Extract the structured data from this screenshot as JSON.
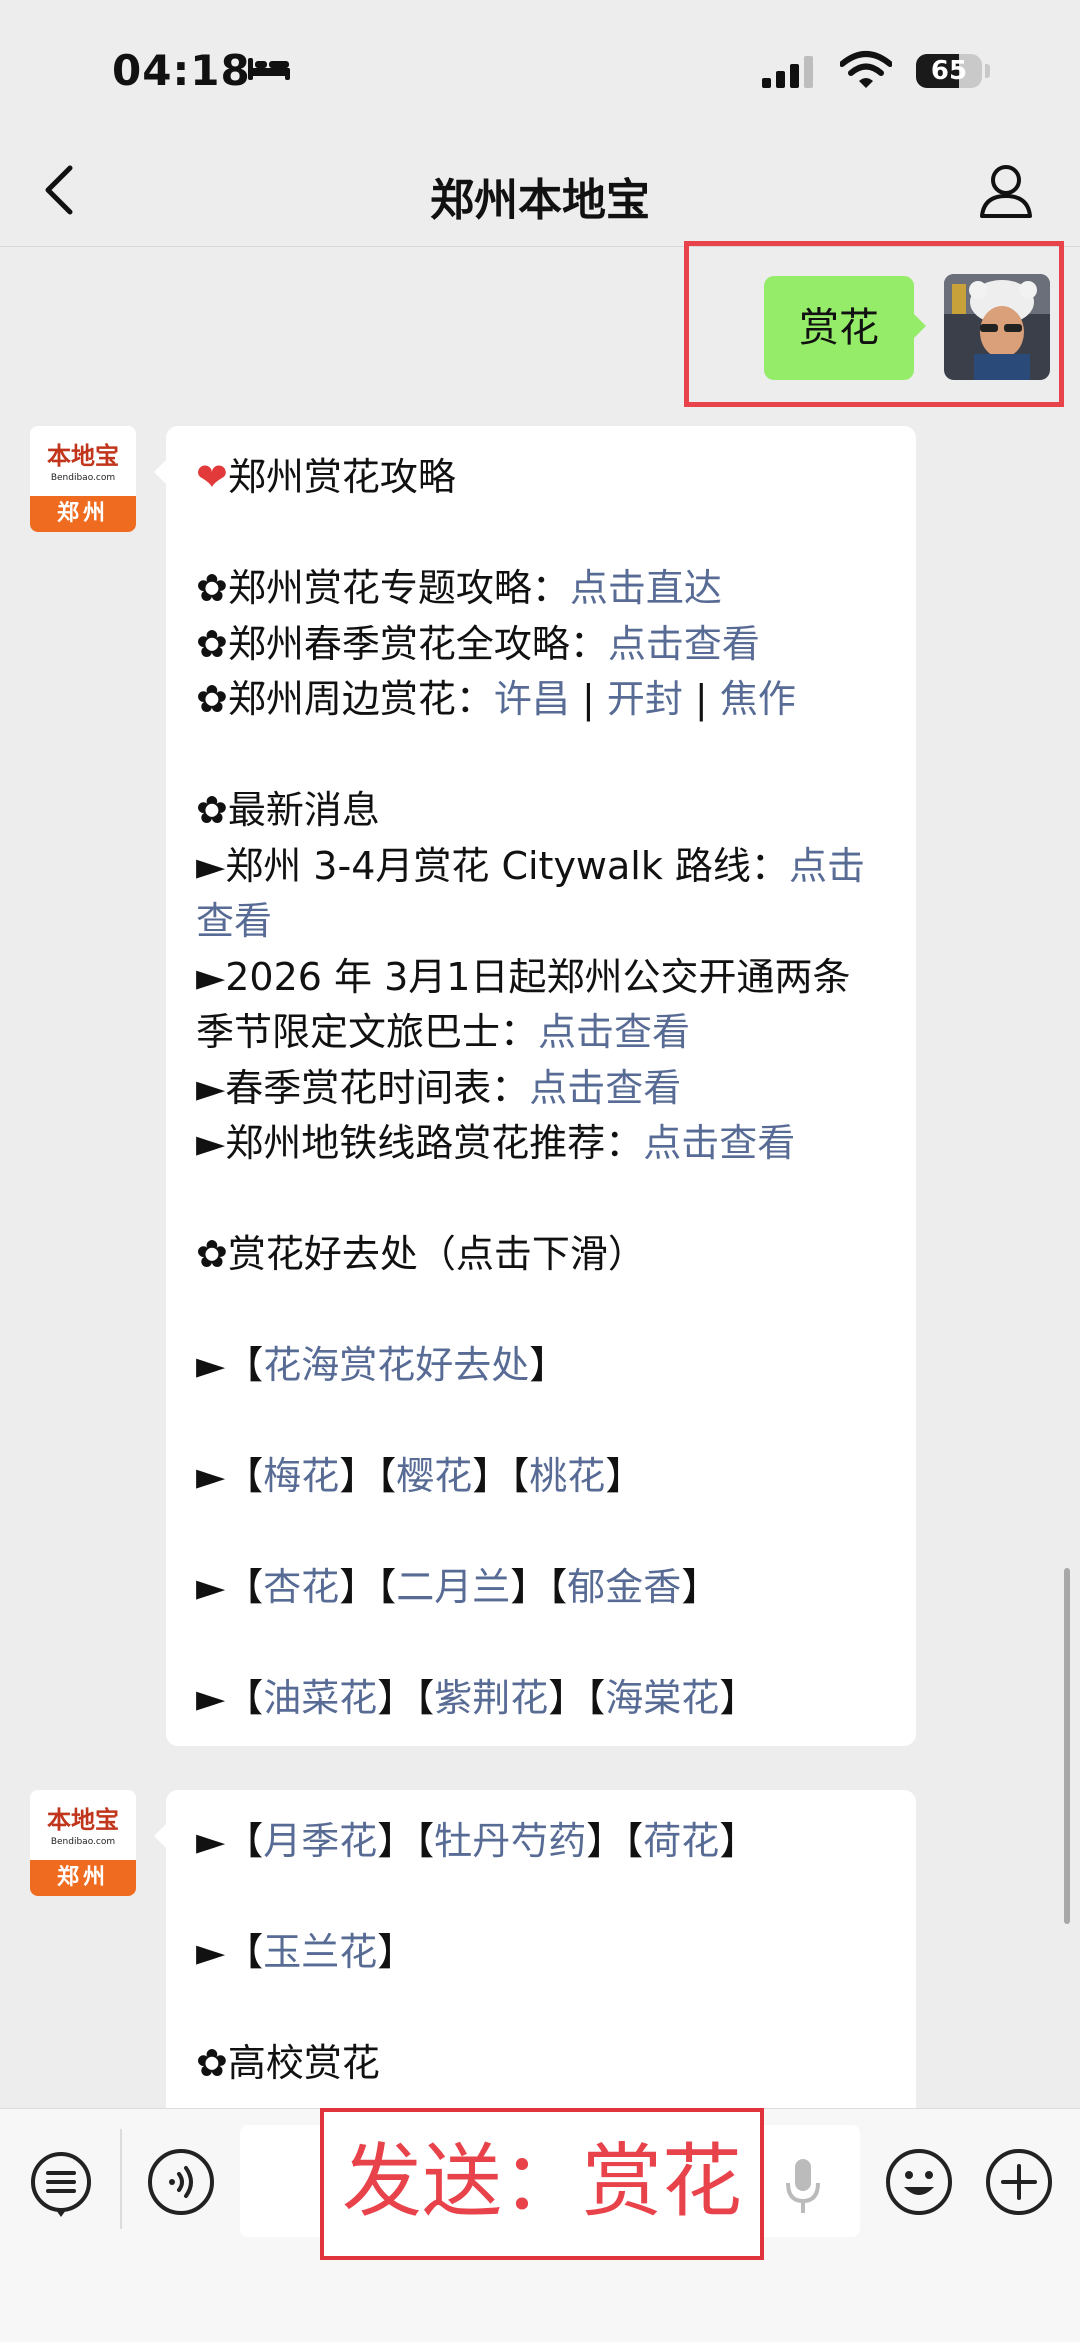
{
  "status_bar": {
    "time": "04:18",
    "battery": "65",
    "battery_level": 0.65
  },
  "nav": {
    "title": "郑州本地宝"
  },
  "my_message": {
    "text": "赏花"
  },
  "bot_avatar": {
    "brand": "本地宝",
    "site": "Bendibao.com",
    "city": "郑州"
  },
  "message1": {
    "heading": "郑州赏花攻略",
    "topics": [
      {
        "label": "✿郑州赏花专题攻略：",
        "link": "点击直达"
      },
      {
        "label": "✿郑州春季赏花全攻略：",
        "link": "点击查看"
      }
    ],
    "nearby": {
      "label": "✿郑州周边赏花：",
      "links": [
        "许昌",
        "开封",
        "焦作"
      ],
      "sep": " | "
    },
    "news_heading": "✿最新消息",
    "news": [
      {
        "label": "►郑州 3-4月赏花 Citywalk 路线：",
        "link": "点击查看"
      },
      {
        "label": "►2026 年 3月1日起郑州公交开通两条季节限定文旅巴士：",
        "link": "点击查看"
      },
      {
        "label": "►春季赏花时间表：",
        "link": "点击查看"
      },
      {
        "label": "►郑州地铁线路赏花推荐：",
        "link": "点击查看"
      }
    ],
    "places_heading": "✿赏花好去处（点击下滑）",
    "places_row1": [
      "花海赏花好去处"
    ],
    "places_row2": [
      "梅花",
      "樱花",
      "桃花"
    ],
    "places_row3": [
      "杏花",
      "二月兰",
      "郁金香"
    ],
    "places_row4": [
      "油菜花",
      "紫荆花",
      "海棠花"
    ]
  },
  "message2": {
    "row1": [
      "月季花",
      "牡丹芍药",
      "荷花"
    ],
    "row2": [
      "玉兰花"
    ],
    "heading": "✿高校赏花"
  },
  "input_bar": {
    "overlay_text": "发送：赏花"
  }
}
